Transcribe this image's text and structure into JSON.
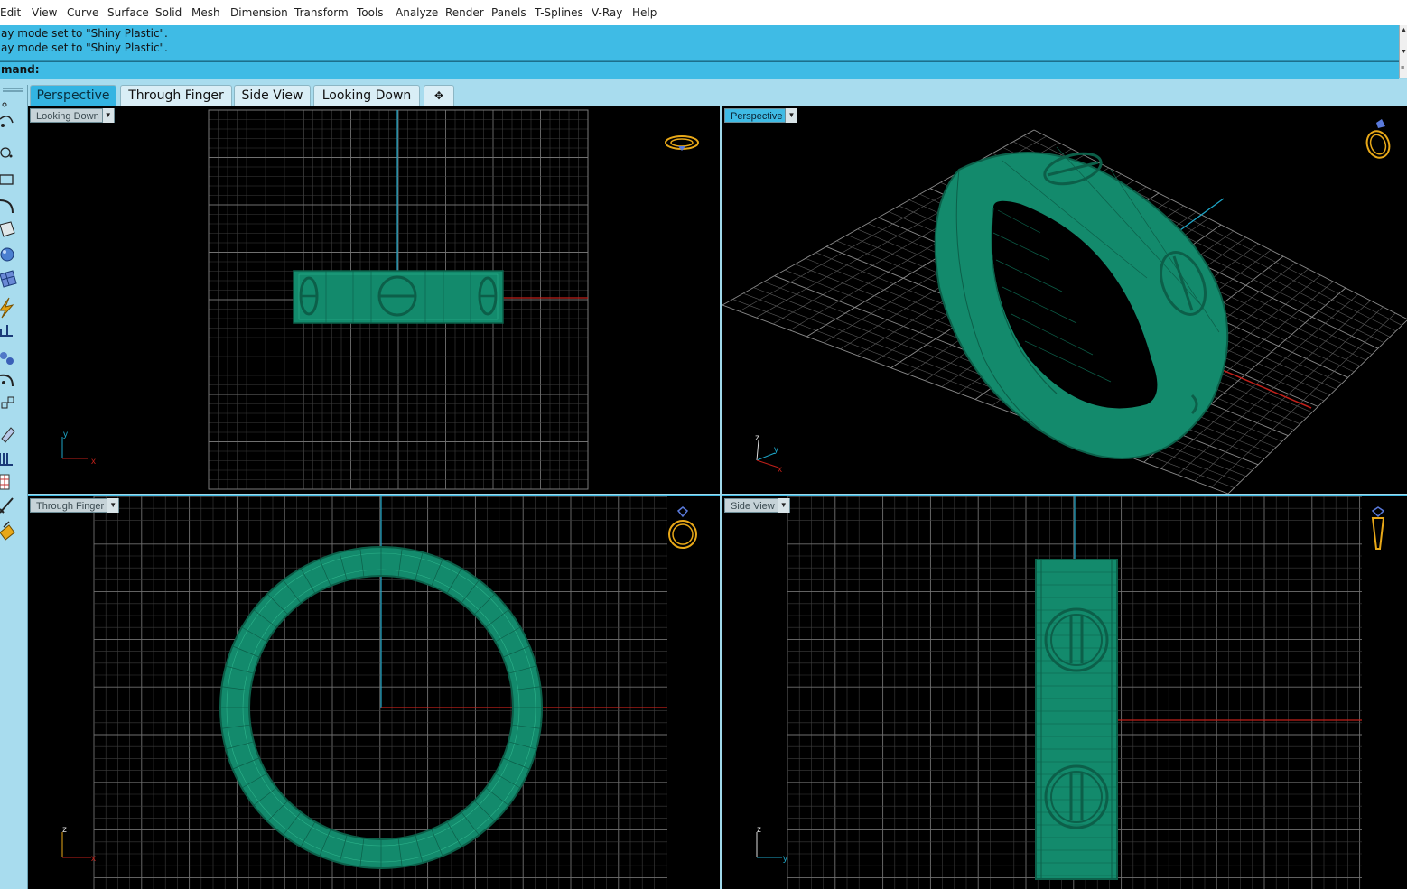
{
  "menu": [
    "Edit",
    "View",
    "Curve",
    "Surface",
    "Solid",
    "Mesh",
    "Dimension",
    "Transform",
    "Tools",
    "Analyze",
    "Render",
    "Panels",
    "T-Splines",
    "V-Ray",
    "Help"
  ],
  "command_history": [
    "ay mode set to \"Shiny Plastic\".",
    "ay mode set to \"Shiny Plastic\"."
  ],
  "command_prompt": "mand:",
  "tabs": [
    "Perspective",
    "Through Finger",
    "Side View",
    "Looking Down"
  ],
  "add_tab_glyph": "✥",
  "viewports": {
    "top_left": {
      "label": "Looking Down",
      "axis_a": "y",
      "axis_b": "x"
    },
    "top_right": {
      "label": "Perspective",
      "axis_a": "z",
      "axis_b": "y",
      "axis_c": "x"
    },
    "bottom_left": {
      "label": "Through Finger",
      "axis_a": "z",
      "axis_b": "x"
    },
    "bottom_right": {
      "label": "Side View",
      "axis_a": "z",
      "axis_b": "y"
    }
  },
  "colors": {
    "ring": "#138a6c",
    "ring_edge": "#0c5f49",
    "grid": "#4a4a4a",
    "grid_major": "#7a7a7a",
    "axis_x": "#c0201a",
    "axis_y": "#1ea6c8",
    "ui_blue": "#3fbbe5",
    "widget": "#e8a818"
  },
  "icons": [
    "point-icon",
    "curve-icon",
    "circle-icon",
    "rectangle-icon",
    "arc-icon",
    "surface-icon",
    "solid-icon",
    "mesh-icon",
    "transform-icon",
    "dimension-icon",
    "sphere-icon",
    "boolean-icon",
    "array-icon",
    "blend-icon",
    "measure-icon",
    "grid-icon",
    "block-icon",
    "render-icon"
  ]
}
